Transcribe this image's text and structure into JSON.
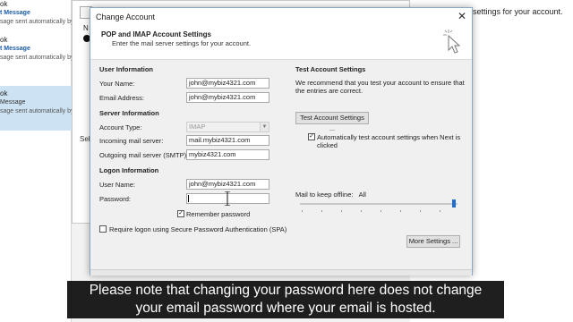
{
  "background": {
    "list_items": [
      {
        "name": "ok",
        "subject": "t Message",
        "preview": "sage sent automatically by"
      },
      {
        "name": "ok",
        "subject": "t Message",
        "preview": "sage sent automatically by"
      },
      {
        "name": "ok",
        "subject": "Message",
        "preview": "sage sent automatically by"
      }
    ],
    "window_label": "N",
    "select_label": "Sel",
    "right_text": "settings for your account."
  },
  "dialog": {
    "title": "Change Account",
    "header_title": "POP and IMAP Account Settings",
    "header_subtitle": "Enter the mail server settings for your account.",
    "user_info": {
      "heading": "User Information",
      "your_name_label": "Your Name:",
      "your_name_value": "john@mybiz4321.com",
      "email_label": "Email Address:",
      "email_value": "john@mybiz4321.com"
    },
    "server_info": {
      "heading": "Server Information",
      "account_type_label": "Account Type:",
      "account_type_value": "IMAP",
      "incoming_label": "Incoming mail server:",
      "incoming_value": "mail.mybiz4321.com",
      "outgoing_label": "Outgoing mail server (SMTP):",
      "outgoing_value": "mybiz4321.com"
    },
    "logon_info": {
      "heading": "Logon Information",
      "username_label": "User Name:",
      "username_value": "john@mybiz4321.com",
      "password_label": "Password:",
      "password_value": "",
      "remember_label": "Remember password",
      "remember_checked": true,
      "spa_label": "Require logon using Secure Password Authentication (SPA)",
      "spa_checked": false
    },
    "test": {
      "heading": "Test Account Settings",
      "description_line1": "We recommend that you test your account to ensure that",
      "description_line2": "the entries are correct.",
      "test_button": "Test Account Settings ...",
      "auto_test_line1": "Automatically test account settings when Next is",
      "auto_test_line2": "clicked",
      "auto_test_checked": true
    },
    "offline": {
      "label": "Mail to keep offline:",
      "value": "All",
      "level": 1.0
    },
    "more_settings_button": "More Settings ..."
  },
  "caption": {
    "line1": "Please note that changing your password here does not change",
    "line2": "your email password where your email is hosted."
  },
  "colors": {
    "accent": "#1f6fd0",
    "selected_item": "#cde3f3",
    "subject_text": "#1a5aa6"
  }
}
